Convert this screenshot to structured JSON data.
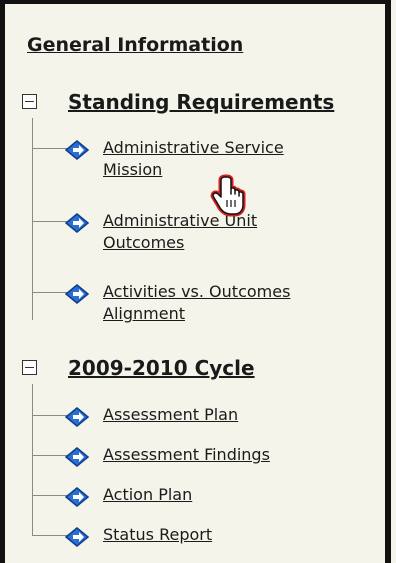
{
  "nav": {
    "general_information": "General Information",
    "sections": [
      {
        "title": "Standing Requirements",
        "items": [
          {
            "line1": "Administrative Service",
            "line2": "Mission"
          },
          {
            "line1": "Administrative Unit",
            "line2": "Outcomes"
          },
          {
            "line1": "Activities vs. Outcomes",
            "line2": "Alignment"
          }
        ]
      },
      {
        "title": "2009-2010 Cycle",
        "items": [
          {
            "line1": "Assessment Plan"
          },
          {
            "line1": "Assessment Findings"
          },
          {
            "line1": "Action Plan"
          },
          {
            "line1": "Status Report"
          }
        ]
      }
    ]
  },
  "icons": {
    "toggle": "minus-box-icon",
    "item": "diamond-arrow-icon",
    "cursor": "hand-pointer-icon"
  },
  "colors": {
    "background": "#f4f4ea",
    "border": "#111111",
    "text": "#1a1a1a",
    "tree_line": "#8a8a8a",
    "diamond_fill": "#2a6ed4",
    "cursor_outline": "#d62020"
  }
}
